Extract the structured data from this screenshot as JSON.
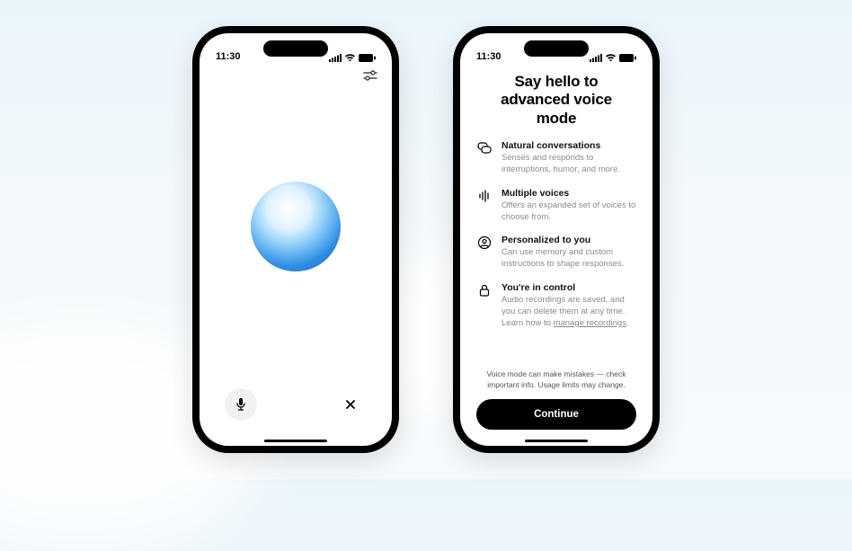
{
  "status": {
    "time": "11:30"
  },
  "phoneA": {
    "settings_icon": "sliders-icon",
    "mic_label": "Microphone",
    "close_label": "Close"
  },
  "phoneB": {
    "title": "Say hello to advanced voice mode",
    "features": [
      {
        "icon": "chat-bubbles-icon",
        "title": "Natural conversations",
        "desc": "Senses and responds to interruptions, humor, and more."
      },
      {
        "icon": "soundwave-icon",
        "title": "Multiple voices",
        "desc": "Offers an expanded set of voices to choose from."
      },
      {
        "icon": "person-circle-icon",
        "title": "Personalized to you",
        "desc": "Can use memory and custom instructions to shape responses."
      },
      {
        "icon": "lock-icon",
        "title": "You're in control",
        "desc_prefix": "Audio recordings are saved, and you can delete them at any time. Learn how to ",
        "desc_link": "manage recordings",
        "desc_suffix": "."
      }
    ],
    "disclaimer": "Voice mode can make mistakes — check important info. Usage limits may change.",
    "continue": "Continue"
  }
}
